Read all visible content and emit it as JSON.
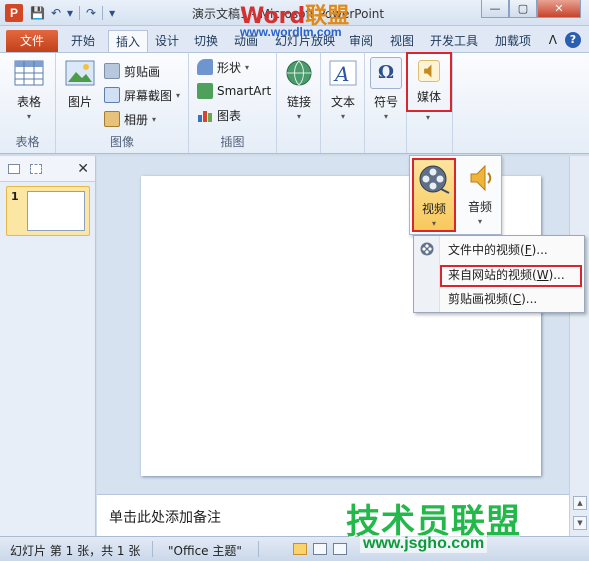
{
  "window": {
    "app_letter": "P",
    "title": "演示文稿1 - Microsoft PowerPoint",
    "watermark_word": "Word",
    "watermark_union": "联盟",
    "watermark_url": "www.wordlm.com",
    "controls": [
      "—",
      "▢",
      "✕"
    ]
  },
  "qat": {
    "save": "💾",
    "undo": "↶",
    "undo_dd": "▾",
    "redo": "↷",
    "customize": "▾"
  },
  "tabs": [
    {
      "label": "文件"
    },
    {
      "label": "开始"
    },
    {
      "label": "插入"
    },
    {
      "label": "设计"
    },
    {
      "label": "切换"
    },
    {
      "label": "动画"
    },
    {
      "label": "幻灯片放映"
    },
    {
      "label": "审阅"
    },
    {
      "label": "视图"
    },
    {
      "label": "开发工具"
    },
    {
      "label": "加载项"
    }
  ],
  "tabbar_right": {
    "collapse": "ᐱ",
    "help": "?"
  },
  "ribbon": {
    "groups": {
      "tables": {
        "label": "表格",
        "button": "表格"
      },
      "images": {
        "label": "图像",
        "picture": "图片",
        "clipart": "剪贴画",
        "screenshot": "屏幕截图",
        "album": "相册"
      },
      "illustrations": {
        "label": "插图",
        "shapes": "形状",
        "smartart": "SmartArt",
        "chart": "图表"
      },
      "links": {
        "label": "链接"
      },
      "text": {
        "label": "文本"
      },
      "symbols": {
        "label": "符号",
        "glyph": "Ω"
      },
      "media": {
        "label": "媒体"
      }
    },
    "dropdown_arrow": "▾"
  },
  "left_pane": {
    "slide_number": "1",
    "close": "✕"
  },
  "media_panel": {
    "video": "视频",
    "audio": "音频"
  },
  "video_menu": {
    "items": [
      {
        "label": "文件中的视频(",
        "key": "F",
        "tail": ")..."
      },
      {
        "label": "来自网站的视频(",
        "key": "W",
        "tail": ")..."
      },
      {
        "label": "剪贴画视频(",
        "key": "C",
        "tail": ")..."
      }
    ]
  },
  "notes": {
    "placeholder": "单击此处添加备注"
  },
  "statusbar": {
    "slide_info": "幻灯片 第 1 张，共 1 张",
    "theme": "\"Office 主题\""
  },
  "watermark": {
    "text": "技术员联盟",
    "url": "www.jsgho.com"
  },
  "colors": {
    "file_tab": "#d24726",
    "highlight": "#d9262e",
    "watermark_green": "#22b84a"
  }
}
